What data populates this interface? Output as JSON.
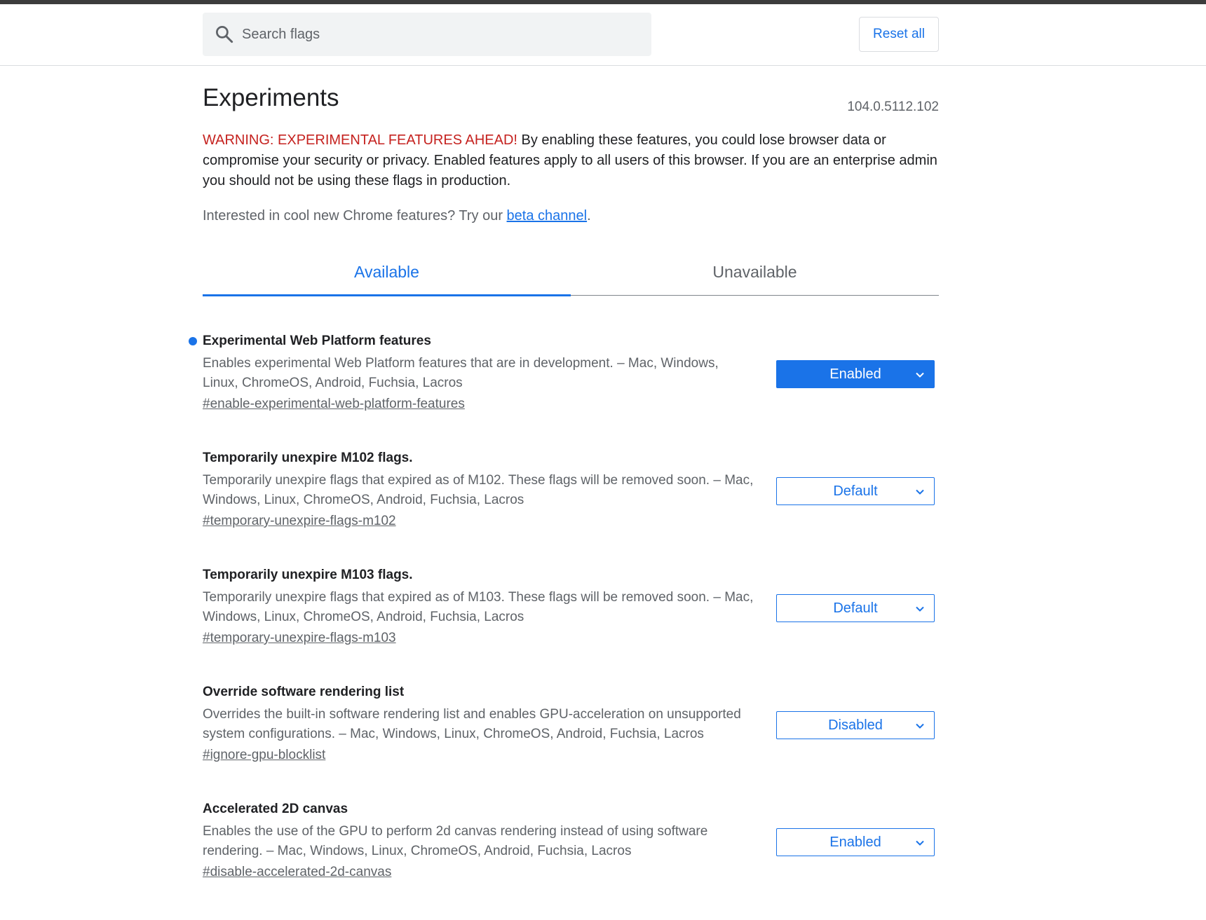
{
  "header": {
    "search_placeholder": "Search flags",
    "reset_label": "Reset all"
  },
  "page": {
    "title": "Experiments",
    "version": "104.0.5112.102",
    "warning_red": "WARNING: EXPERIMENTAL FEATURES AHEAD!",
    "warning_text": " By enabling these features, you could lose browser data or compromise your security or privacy. Enabled features apply to all users of this browser. If you are an enterprise admin you should not be using these flags in production.",
    "interest_text": "Interested in cool new Chrome features? Try our ",
    "interest_link": "beta channel",
    "interest_end": "."
  },
  "tabs": [
    {
      "label": "Available",
      "active": true
    },
    {
      "label": "Unavailable",
      "active": false
    }
  ],
  "flags": [
    {
      "name": "Experimental Web Platform features",
      "description": "Enables experimental Web Platform features that are in development. – Mac, Windows, Linux, ChromeOS, Android, Fuchsia, Lacros",
      "link": "#enable-experimental-web-platform-features",
      "value": "Enabled",
      "modified": true
    },
    {
      "name": "Temporarily unexpire M102 flags.",
      "description": "Temporarily unexpire flags that expired as of M102. These flags will be removed soon. – Mac, Windows, Linux, ChromeOS, Android, Fuchsia, Lacros",
      "link": "#temporary-unexpire-flags-m102",
      "value": "Default",
      "modified": false
    },
    {
      "name": "Temporarily unexpire M103 flags.",
      "description": "Temporarily unexpire flags that expired as of M103. These flags will be removed soon. – Mac, Windows, Linux, ChromeOS, Android, Fuchsia, Lacros",
      "link": "#temporary-unexpire-flags-m103",
      "value": "Default",
      "modified": false
    },
    {
      "name": "Override software rendering list",
      "description": "Overrides the built-in software rendering list and enables GPU-acceleration on unsupported system configurations. – Mac, Windows, Linux, ChromeOS, Android, Fuchsia, Lacros",
      "link": "#ignore-gpu-blocklist",
      "value": "Disabled",
      "modified": false
    },
    {
      "name": "Accelerated 2D canvas",
      "description": "Enables the use of the GPU to perform 2d canvas rendering instead of using software rendering. – Mac, Windows, Linux, ChromeOS, Android, Fuchsia, Lacros",
      "link": "#disable-accelerated-2d-canvas",
      "value": "Enabled",
      "modified": false
    }
  ],
  "colors": {
    "accent": "#1a73e8",
    "warning": "#c5221f"
  },
  "icons": {
    "search": "search-icon",
    "dropdown": "chevron-down-icon"
  }
}
